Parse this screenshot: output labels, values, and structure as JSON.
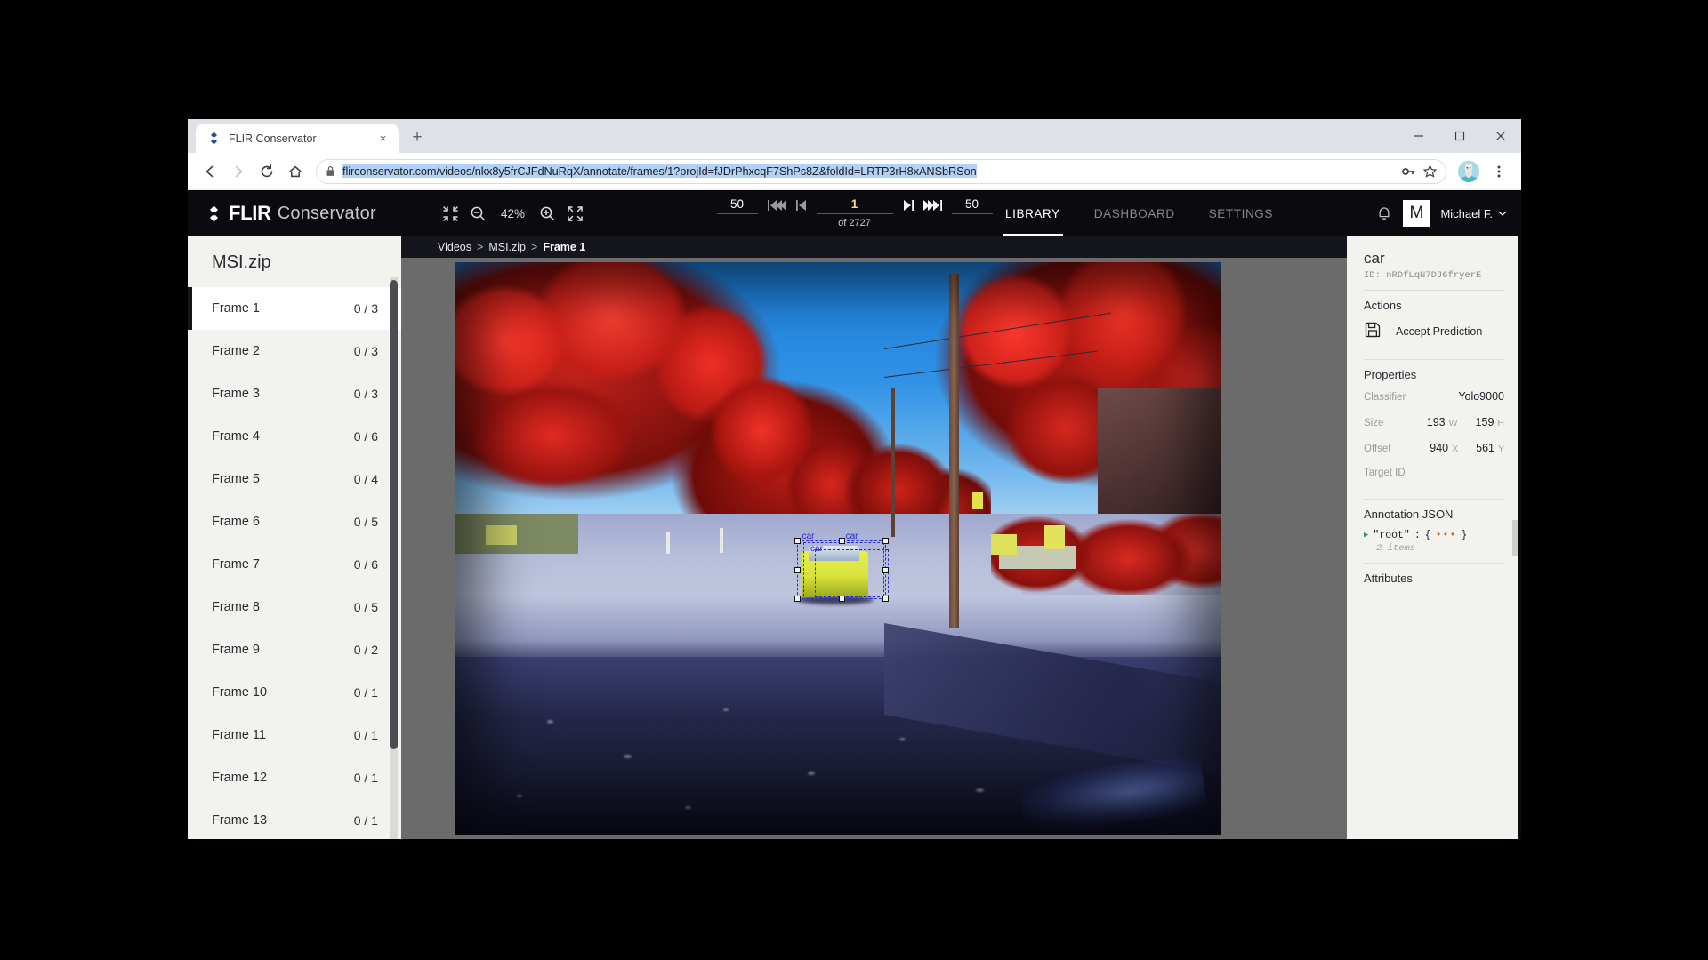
{
  "browser": {
    "tab": {
      "title": "FLIR Conservator",
      "favicon": "flir-diamond-icon",
      "close": "×"
    },
    "new_tab": "+",
    "window_controls": {
      "minimize": "−",
      "maximize": "□",
      "close": "✕"
    },
    "nav": {
      "back": "←",
      "forward": "→",
      "reload": "↻",
      "home": "⌂"
    },
    "url": "flirconservator.com/videos/nkx8y5frCJFdNuRqX/annotate/frames/1?projId=fJDrPhxcqF7ShPs8Z&foldId=LRTP3rH8xANSbRSon",
    "omni_icons": {
      "lock": "padlock-icon",
      "key": "key-icon",
      "bookmark": "star-icon",
      "menu": "three-dot-menu-icon"
    }
  },
  "app": {
    "brand": {
      "primary": "FLIR",
      "secondary": "Conservator"
    },
    "zoom_tools": {
      "fit_screen": "fit-to-screen-icon",
      "zoom_out": "zoom-out-icon",
      "level": "42%",
      "zoom_in": "zoom-in-icon",
      "fullscreen": "expand-icon"
    },
    "frame_nav": {
      "skip_back_value": "50",
      "skip_back_icon": "skip-back-multi-icon",
      "step_back_icon": "step-back-icon",
      "current_frame": "1",
      "total_label": "of 2727",
      "step_forward_icon": "step-forward-icon",
      "skip_forward_icon": "skip-forward-multi-icon",
      "skip_forward_value": "50"
    },
    "tabs": [
      {
        "label": "LIBRARY",
        "active": true
      },
      {
        "label": "DASHBOARD",
        "active": false
      },
      {
        "label": "SETTINGS",
        "active": false
      }
    ],
    "notifications_icon": "bell-icon",
    "user": {
      "initial": "M",
      "name": "Michael F.",
      "chevron": "⌄"
    }
  },
  "sidebar": {
    "title": "MSI.zip",
    "frames": [
      {
        "name": "Frame 1",
        "count": "0 / 3",
        "selected": true
      },
      {
        "name": "Frame 2",
        "count": "0 / 3",
        "selected": false
      },
      {
        "name": "Frame 3",
        "count": "0 / 3",
        "selected": false
      },
      {
        "name": "Frame 4",
        "count": "0 / 6",
        "selected": false
      },
      {
        "name": "Frame 5",
        "count": "0 / 4",
        "selected": false
      },
      {
        "name": "Frame 6",
        "count": "0 / 5",
        "selected": false
      },
      {
        "name": "Frame 7",
        "count": "0 / 6",
        "selected": false
      },
      {
        "name": "Frame 8",
        "count": "0 / 5",
        "selected": false
      },
      {
        "name": "Frame 9",
        "count": "0 / 2",
        "selected": false
      },
      {
        "name": "Frame 10",
        "count": "0 / 1",
        "selected": false
      },
      {
        "name": "Frame 11",
        "count": "0 / 1",
        "selected": false
      },
      {
        "name": "Frame 12",
        "count": "0 / 1",
        "selected": false
      },
      {
        "name": "Frame 13",
        "count": "0 / 1",
        "selected": false
      }
    ]
  },
  "breadcrumb": {
    "root": "Videos",
    "sep": ">",
    "folder": "MSI.zip",
    "current": "Frame 1"
  },
  "viewer": {
    "annotations": [
      {
        "label": "car"
      },
      {
        "label": "car"
      },
      {
        "label": "car"
      }
    ]
  },
  "right_panel": {
    "title": "car",
    "id": "ID: nRDfLqN7DJ6fryerE",
    "actions_heading": "Actions",
    "accept_prediction": {
      "icon": "save-floppy-icon",
      "label": "Accept Prediction"
    },
    "properties_heading": "Properties",
    "properties": {
      "classifier_label": "Classifier",
      "classifier_value": "Yolo9000",
      "size_label": "Size",
      "size_w": "193",
      "size_w_unit": "W",
      "size_h": "159",
      "size_h_unit": "H",
      "offset_label": "Offset",
      "offset_x": "940",
      "offset_x_unit": "X",
      "offset_y": "561",
      "offset_y_unit": "Y",
      "target_id_label": "Target ID"
    },
    "json_heading": "Annotation JSON",
    "json": {
      "arrow": "▶",
      "key": "\"root\"",
      "colon": ":",
      "open": "{",
      "dots": "•••",
      "close": "}",
      "items": "2 items"
    },
    "attributes_heading": "Attributes"
  },
  "colors": {
    "app_header_bg": "#0a0a0f",
    "sidebar_bg": "#f2f2ef",
    "accent_yellow": "#f2e27c",
    "annotation_blue": "#2b2bd0",
    "url_highlight": "#b3d0f7"
  }
}
